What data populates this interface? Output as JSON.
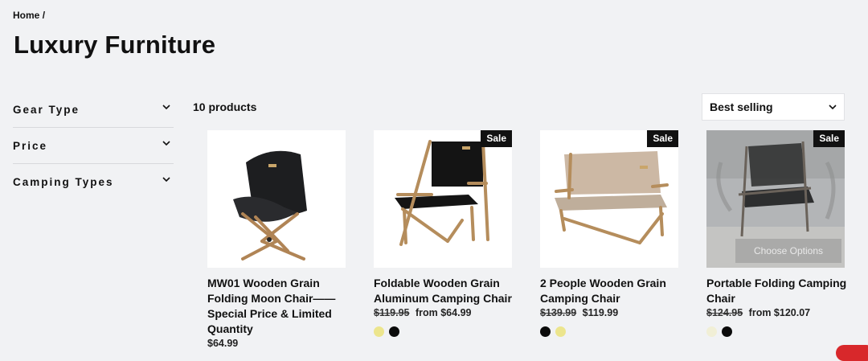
{
  "breadcrumb": {
    "home": "Home",
    "separator": "/"
  },
  "page": {
    "title": "Luxury Furniture"
  },
  "filters": [
    {
      "label": "Gear Type",
      "icon": "chevron-down-icon"
    },
    {
      "label": "Price",
      "icon": "chevron-down-icon"
    },
    {
      "label": "Camping Types",
      "icon": "chevron-down-icon"
    }
  ],
  "results": {
    "count_label": "10 products"
  },
  "sort": {
    "selected": "Best selling",
    "icon": "chevron-down-icon"
  },
  "products": [
    {
      "title": "MW01 Wooden Grain Folding Moon Chair——Special Price & Limited Quantity",
      "badge": "",
      "old_price": "",
      "price": "$64.99",
      "swatches": []
    },
    {
      "title": "Foldable Wooden Grain Aluminum Camping Chair",
      "badge": "Sale",
      "old_price": "$119.95",
      "price": "from $64.99",
      "swatches": [
        "#ece58d",
        "#0b0b0b"
      ]
    },
    {
      "title": "2 People Wooden Grain Camping Chair",
      "badge": "Sale",
      "old_price": "$139.99",
      "price": "$119.99",
      "swatches": [
        "#0b0b0b",
        "#ece58d"
      ]
    },
    {
      "title": "Portable Folding Camping Chair",
      "badge": "Sale",
      "old_price": "$124.95",
      "price": "from $120.07",
      "swatches": [
        "#f1efd6",
        "#0b0b0b"
      ],
      "hover_button": "Choose Options"
    }
  ],
  "colors": {
    "background": "#f1f2f4",
    "sale_badge": "#111111",
    "accent_red": "#d8282b"
  }
}
